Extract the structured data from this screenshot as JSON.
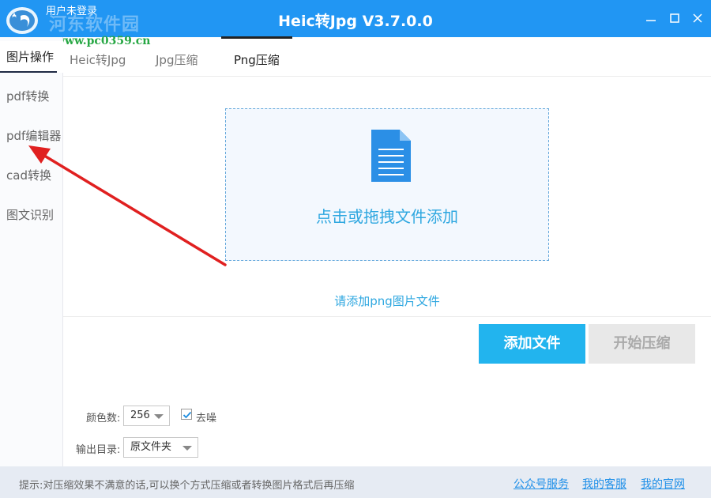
{
  "window": {
    "title": "Heic转Jpg V3.7.0.0",
    "user_status": "用户未登录",
    "watermark_name": "河东软件园",
    "watermark_url": "www.pc0359.cn"
  },
  "sidebar": {
    "items": [
      {
        "label": "图片操作",
        "active": true
      },
      {
        "label": "pdf转换",
        "active": false
      },
      {
        "label": "pdf编辑器",
        "active": false
      },
      {
        "label": "cad转换",
        "active": false
      },
      {
        "label": "图文识别",
        "active": false
      }
    ]
  },
  "tabs": [
    {
      "label": "Heic转Jpg",
      "active": false
    },
    {
      "label": "Jpg压缩",
      "active": false
    },
    {
      "label": "Png压缩",
      "active": true
    }
  ],
  "dropzone": {
    "text": "点击或拖拽文件添加",
    "icon": "document-icon"
  },
  "hint": "请添加png图片文件",
  "buttons": {
    "add": "添加文件",
    "start": "开始压缩"
  },
  "settings": {
    "colors_label": "颜色数:",
    "colors_value": "256",
    "denoise_label": "去噪",
    "denoise_checked": true,
    "output_label": "输出目录:",
    "output_value": "原文件夹"
  },
  "status": {
    "tip": "提示:对压缩效果不满意的话,可以换个方式压缩或者转换图片格式后再压缩",
    "links": [
      "公众号服务",
      "我的客服",
      "我的官网"
    ]
  },
  "colors": {
    "titlebar": "#2196f3",
    "accent": "#22b4ee",
    "link": "#1e8fe8",
    "annotation_arrow": "#e02020"
  }
}
